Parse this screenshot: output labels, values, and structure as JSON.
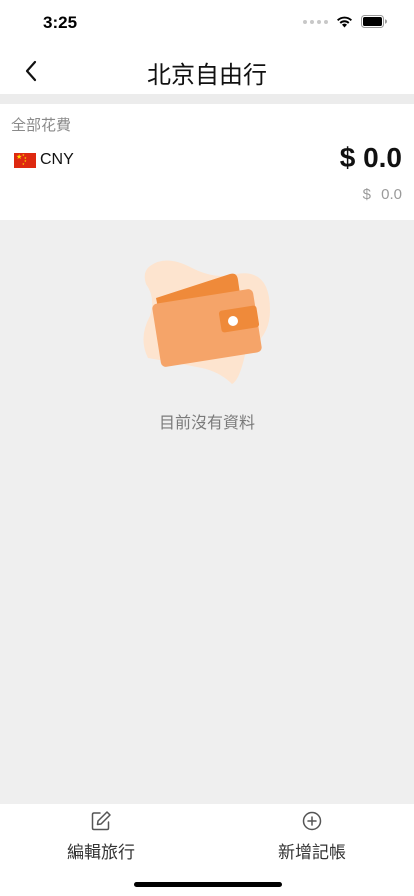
{
  "status_bar": {
    "time": "3:25"
  },
  "nav": {
    "title": "北京自由行",
    "back_icon": "chevron-left-icon"
  },
  "summary": {
    "label": "全部花費",
    "currency_code": "CNY",
    "total_amount": "$ 0.0",
    "secondary_amount": "$ 0.0"
  },
  "empty_state": {
    "message": "目前沒有資料",
    "colors": {
      "blob": "#fde4cf",
      "wallet": "#f5a469",
      "wallet_flap": "#ef8a3a",
      "clasp": "#ef8a3a"
    }
  },
  "bottom_bar": {
    "edit_label": "編輯旅行",
    "edit_icon": "edit-icon",
    "add_label": "新增記帳",
    "add_icon": "plus-circle-icon"
  }
}
